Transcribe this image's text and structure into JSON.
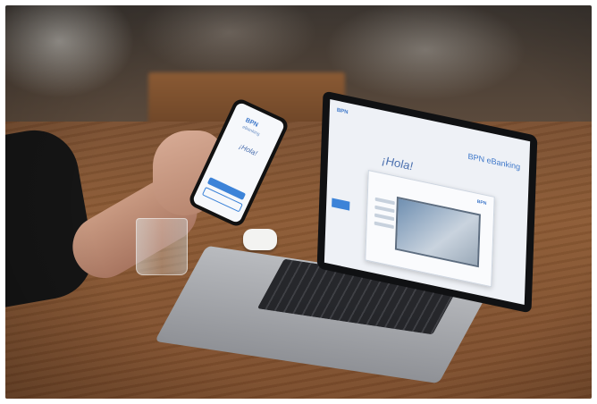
{
  "photo": {
    "phone": {
      "brand_logo": "BPN",
      "subtitle": "eBanking",
      "greeting": "¡Hola!"
    },
    "laptop": {
      "brand_logo_left": "BPN",
      "brand_logo_right": "BPN eBanking",
      "greeting": "¡Hola!",
      "modal_logo": "BPN"
    }
  }
}
